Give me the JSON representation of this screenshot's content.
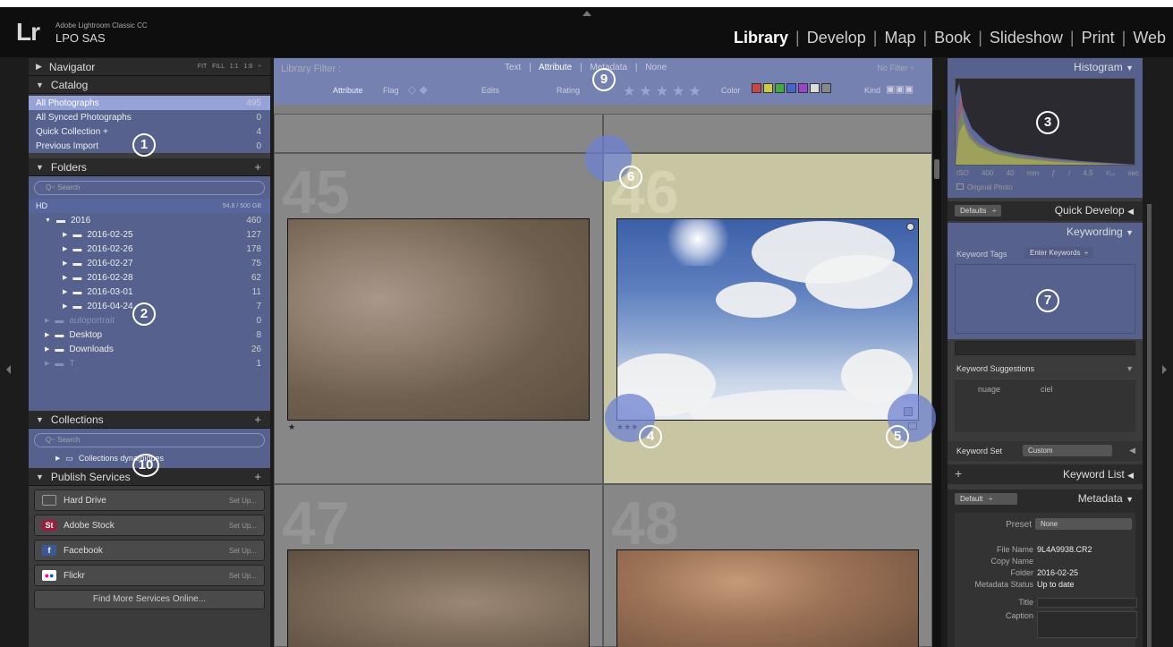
{
  "app": {
    "logo": "Lr",
    "product": "Adobe Lightroom Classic CC",
    "catalog_name": "LPO SAS"
  },
  "modules": [
    "Library",
    "Develop",
    "Map",
    "Book",
    "Slideshow",
    "Print",
    "Web"
  ],
  "active_module": "Library",
  "left": {
    "navigator": {
      "title": "Navigator",
      "options": "FIT  FILL  1:1  1:8 ÷"
    },
    "catalog": {
      "title": "Catalog",
      "items": [
        {
          "label": "All Photographs",
          "count": "495"
        },
        {
          "label": "All Synced Photographs",
          "count": "0"
        },
        {
          "label": "Quick Collection +",
          "count": "4"
        },
        {
          "label": "Previous Import",
          "count": "0"
        }
      ]
    },
    "folders": {
      "title": "Folders",
      "search_placeholder": "Q~ Search",
      "volume": {
        "label": "HD",
        "size": "94,8 / 500 GB"
      },
      "items": [
        {
          "label": "2016",
          "count": "460"
        },
        {
          "label": "2016-02-25",
          "count": "127"
        },
        {
          "label": "2016-02-26",
          "count": "178"
        },
        {
          "label": "2016-02-27",
          "count": "75"
        },
        {
          "label": "2016-02-28",
          "count": "62"
        },
        {
          "label": "2016-03-01",
          "count": "11"
        },
        {
          "label": "2016-04-24",
          "count": "7"
        },
        {
          "label": "autoportrait",
          "count": "0"
        },
        {
          "label": "Desktop",
          "count": "8"
        },
        {
          "label": "Downloads",
          "count": "26"
        },
        {
          "label": "T",
          "count": "1"
        }
      ]
    },
    "collections": {
      "title": "Collections",
      "search_placeholder": "Q~ Search",
      "items": [
        {
          "label": "Collections dynamiques"
        }
      ]
    },
    "publish": {
      "title": "Publish Services",
      "services": [
        {
          "label": "Hard Drive",
          "action": "Set Up..."
        },
        {
          "label": "Adobe Stock",
          "action": "Set Up..."
        },
        {
          "label": "Facebook",
          "action": "Set Up..."
        },
        {
          "label": "Flickr",
          "action": "Set Up..."
        }
      ],
      "find_more": "Find More Services Online..."
    }
  },
  "filter": {
    "title": "Library Filter :",
    "tabs": [
      "Text",
      "Attribute",
      "Metadata",
      "None"
    ],
    "active_tab": "Attribute",
    "no_filter": "No Filter ÷",
    "attribute_label": "Attribute",
    "flag_label": "Flag",
    "edits_label": "Edits",
    "rating_label": "Rating",
    "color_label": "Color",
    "kind_label": "Kind",
    "stars": "★★★★★",
    "colors": [
      "#c44",
      "#cc4",
      "#4a4",
      "#46c",
      "#94c",
      "#ddd",
      "#888"
    ]
  },
  "grid": {
    "cells": [
      {
        "num": "45",
        "stars": "★"
      },
      {
        "num": "46",
        "stars": "★★★"
      },
      {
        "num": "47",
        "stars": ""
      },
      {
        "num": "48",
        "stars": ""
      }
    ]
  },
  "right": {
    "histogram": {
      "title": "Histogram",
      "iso": "ISO 400",
      "focal": "40 mm",
      "aperture": "ƒ / 4,5",
      "shutter": "¹⁄₆₀ sec",
      "original_photo": "Original Photo"
    },
    "quick_develop": {
      "preset": "Defaults",
      "title": "Quick Develop"
    },
    "keywording": {
      "title": "Keywording",
      "tags_label": "Keyword Tags",
      "tags_value": "Enter Keywords",
      "suggestions_title": "Keyword Suggestions",
      "suggestions": [
        "nuage",
        "ciel"
      ],
      "set_label": "Keyword Set",
      "set_value": "Custom"
    },
    "keyword_list": {
      "title": "Keyword List"
    },
    "metadata": {
      "preset_dropdown": "Default",
      "title": "Metadata",
      "preset_label": "Preset",
      "preset_value": "None",
      "fields": [
        {
          "label": "File Name",
          "value": "9L4A9938.CR2"
        },
        {
          "label": "Copy Name",
          "value": ""
        },
        {
          "label": "Folder",
          "value": "2016-02-25"
        },
        {
          "label": "Metadata Status",
          "value": "Up to date"
        },
        {
          "label": "Title",
          "value": ""
        },
        {
          "label": "Caption",
          "value": ""
        }
      ]
    }
  },
  "callouts": [
    "1",
    "2",
    "3",
    "4",
    "5",
    "6",
    "7",
    "9",
    "10"
  ]
}
